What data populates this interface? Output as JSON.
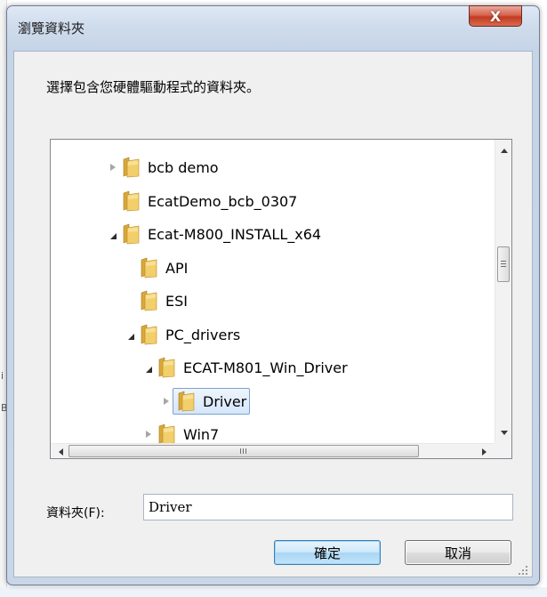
{
  "background": {
    "left_fragments": [
      "i",
      "B"
    ]
  },
  "dialog": {
    "title": "瀏覽資料夾",
    "close_glyph": "X",
    "instruction": "選擇包含您硬體驅動程式的資料夾。",
    "tree": {
      "items": [
        {
          "label": "bcb demo",
          "depth": 0,
          "state": "collapsed"
        },
        {
          "label": "EcatDemo_bcb_0307",
          "depth": 0,
          "state": "leaf"
        },
        {
          "label": "Ecat-M800_INSTALL_x64",
          "depth": 0,
          "state": "expanded"
        },
        {
          "label": "API",
          "depth": 1,
          "state": "leaf"
        },
        {
          "label": "ESI",
          "depth": 1,
          "state": "leaf"
        },
        {
          "label": "PC_drivers",
          "depth": 1,
          "state": "expanded"
        },
        {
          "label": "ECAT-M801_Win_Driver",
          "depth": 2,
          "state": "expanded"
        },
        {
          "label": "Driver",
          "depth": 3,
          "state": "collapsed",
          "selected": true
        },
        {
          "label": "Win7",
          "depth": 2,
          "state": "collapsed"
        }
      ]
    },
    "folder_label": "資料夾(F):",
    "folder_value": "Driver",
    "ok_label": "確定",
    "cancel_label": "取消"
  },
  "colors": {
    "selection_fill": "#d5e6fb",
    "selection_border": "#7da2ce",
    "close_button": "#c13b22",
    "folder_front": "#f2cf6a",
    "folder_back": "#d9a83a"
  },
  "icons": {
    "folder": "folder-icon",
    "expand": "chevron-right-icon",
    "collapse": "expanded-triangle-icon",
    "close": "close-icon"
  }
}
